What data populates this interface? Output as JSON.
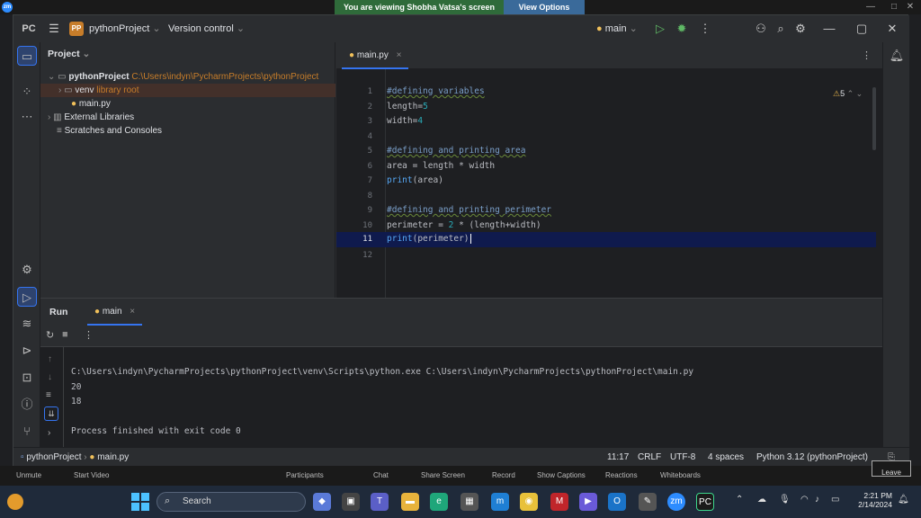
{
  "zoom": {
    "viewing_banner": "You are viewing Shobha Vatsa's screen",
    "view_options": "View Options",
    "bottom": {
      "unmute": "Unmute",
      "start_video": "Start Video",
      "participants": "Participants",
      "chat": "Chat",
      "share_screen": "Share Screen",
      "record": "Record",
      "show_captions": "Show Captions",
      "reactions": "Reactions",
      "whiteboards": "Whiteboards",
      "leave": "Leave"
    }
  },
  "ide": {
    "title": {
      "project_badge": "PP",
      "project_name": "pythonProject",
      "version_control": "Version control",
      "run_config": "main"
    },
    "project_panel": {
      "header": "Project",
      "root_name": "pythonProject",
      "root_path": "C:\\Users\\indyn\\PycharmProjects\\pythonProject",
      "venv": "venv",
      "venv_note": "library root",
      "main_file": "main.py",
      "external_libraries": "External Libraries",
      "scratches": "Scratches and Consoles"
    },
    "editor": {
      "tab": "main.py",
      "warnings_count": "5",
      "line_numbers": [
        "1",
        "2",
        "3",
        "4",
        "5",
        "6",
        "7",
        "8",
        "9",
        "10",
        "11",
        "12"
      ],
      "lines": {
        "l1": "#defining variables",
        "l2_name": "length",
        "l2_op": "=",
        "l2_val": "5",
        "l3_name": "width",
        "l3_op": "=",
        "l3_val": "4",
        "l5": "#defining and printing area",
        "l6": "area = length * width",
        "l7_fn": "print",
        "l7_arg": "(area)",
        "l9": "#defining and printing perimeter",
        "l10_a": "perimeter = ",
        "l10_num": "2",
        "l10_b": " * (length+width)",
        "l11_fn": "print",
        "l11_arg": "(perimeter)"
      }
    },
    "run": {
      "label": "Run",
      "tab": "main",
      "command": "C:\\Users\\indyn\\PycharmProjects\\pythonProject\\venv\\Scripts\\python.exe C:\\Users\\indyn\\PycharmProjects\\pythonProject\\main.py",
      "out1": "20",
      "out2": "18",
      "finished": "Process finished with exit code 0"
    },
    "status": {
      "breadcrumb_project": "pythonProject",
      "breadcrumb_file": "main.py",
      "position": "11:17",
      "line_sep": "CRLF",
      "encoding": "UTF-8",
      "indent": "4 spaces",
      "interpreter": "Python 3.12 (pythonProject)"
    }
  },
  "taskbar": {
    "search_placeholder": "Search",
    "time": "2:21 PM",
    "date": "2/14/2024"
  },
  "colors": {
    "accent": "#3574f0",
    "comment": "#7a9fc9",
    "number": "#2aacb8",
    "function": "#56a8f5"
  }
}
